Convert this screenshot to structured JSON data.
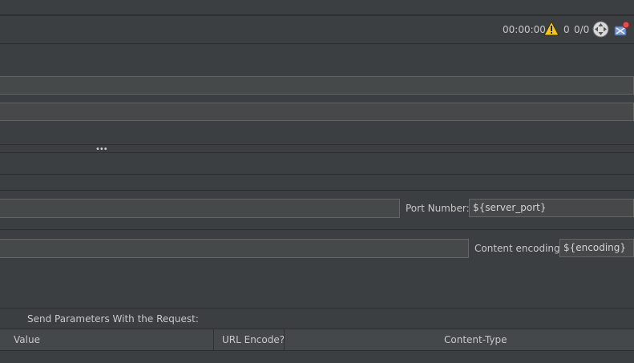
{
  "toolbar": {
    "elapsed_time": "00:00:00",
    "warning_count": "0",
    "threads": "0/0",
    "icons": [
      "warning-icon",
      "remote-start-icon",
      "clear-all-icon"
    ]
  },
  "server": {
    "port_label": "Port Number:",
    "port_value": "${server_port}"
  },
  "path": {
    "encoding_label": "Content encoding:",
    "encoding_value": "${encoding}"
  },
  "parameters": {
    "title": "Send Parameters With the Request:",
    "columns": [
      "Value",
      "URL Encode?",
      "Content-Type"
    ]
  },
  "colors": {
    "background": "#3c3f41",
    "field_background": "#45494a",
    "border": "#646464",
    "warning": "#f5c518"
  }
}
